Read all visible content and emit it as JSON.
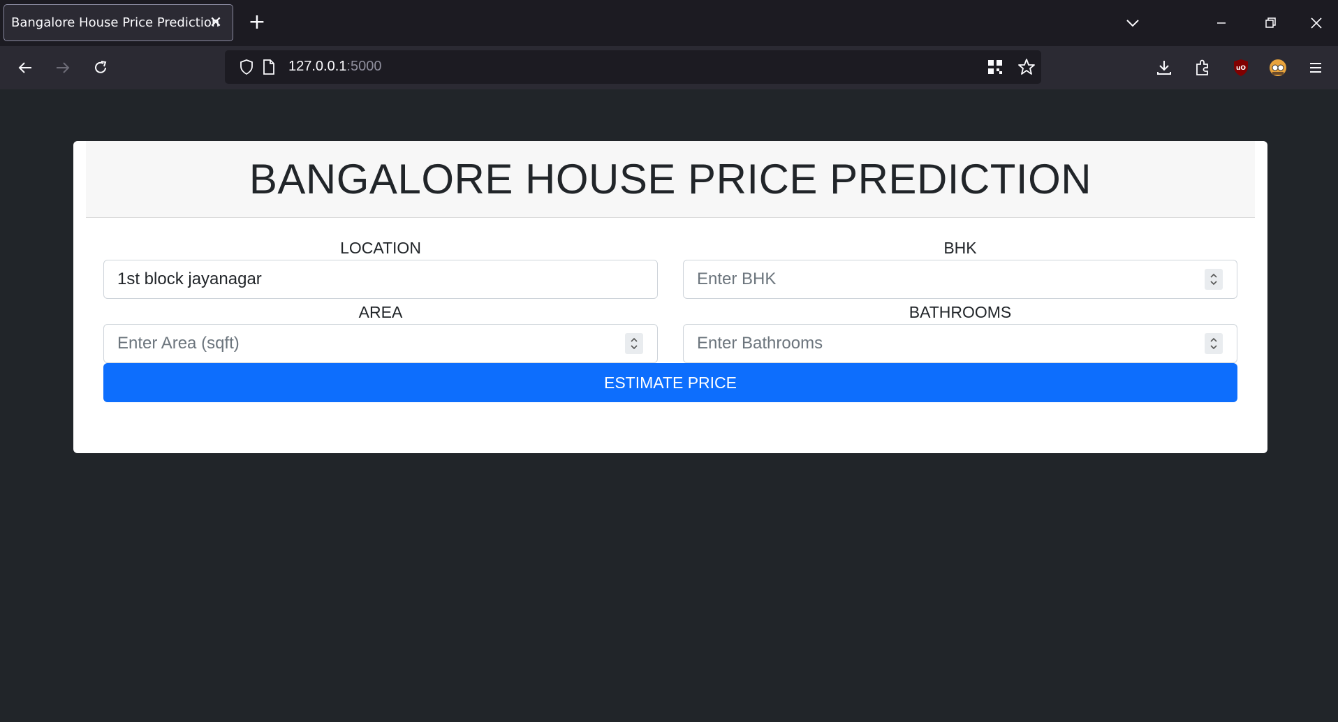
{
  "browser": {
    "tab_title": "Bangalore House Price Prediction",
    "url_host": "127.0.0.1",
    "url_port": ":5000"
  },
  "page": {
    "title": "BANGALORE HOUSE PRICE PREDICTION",
    "location": {
      "label": "LOCATION",
      "value": "1st block jayanagar"
    },
    "bhk": {
      "label": "BHK",
      "placeholder": "Enter BHK"
    },
    "area": {
      "label": "AREA",
      "placeholder": "Enter Area (sqft)"
    },
    "bathrooms": {
      "label": "BATHROOMS",
      "placeholder": "Enter Bathrooms"
    },
    "estimate_button": "ESTIMATE PRICE"
  },
  "colors": {
    "page_bg": "#212529",
    "button_primary": "#0d6efd",
    "browser_toolbar": "#2b2a33",
    "browser_tabbar": "#1c1b22"
  }
}
